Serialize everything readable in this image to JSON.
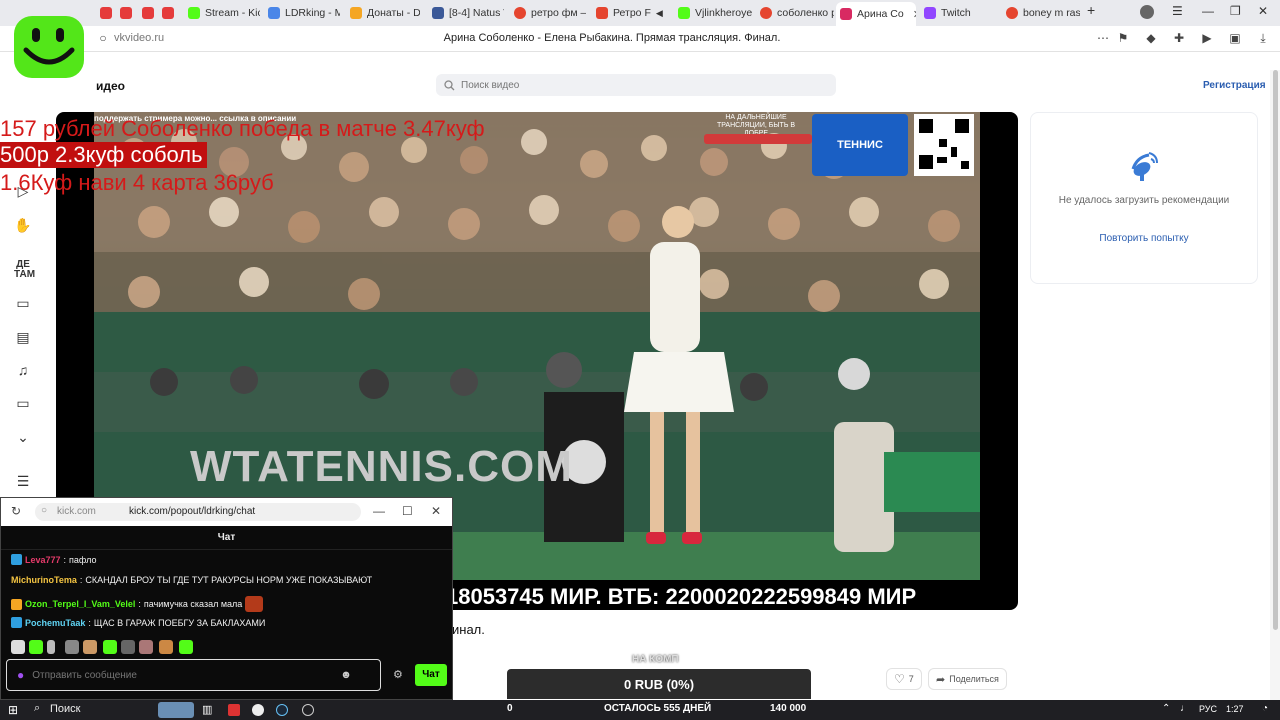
{
  "browser": {
    "tabs": [
      {
        "label": "Stream - Kick",
        "color": "#53fc18"
      },
      {
        "label": "LDRking - Me",
        "color": "#4a86e8"
      },
      {
        "label": "Донаты - Do",
        "color": "#f5a623"
      },
      {
        "label": "[8-4] Natus V",
        "color": "#3b5998"
      },
      {
        "label": "ретро фм —",
        "color": "#e5452f"
      },
      {
        "label": "Ретро F",
        "color": "#e5452f"
      },
      {
        "label": "Vjlinkheroye",
        "color": "#53fc18"
      },
      {
        "label": "соболенко р",
        "color": "#e5452f"
      },
      {
        "label": "Арина Со",
        "color": "#d82a62",
        "active": true
      },
      {
        "label": "Twitch",
        "color": "#9146ff"
      },
      {
        "label": "boney m rasp",
        "color": "#e5452f"
      }
    ],
    "url": "vkvideo.ru",
    "page_title": "Арина Соболенко - Елена Рыбакина. Прямая трансляция. Финал."
  },
  "header": {
    "brand": "идео",
    "search_placeholder": "Поиск видео",
    "register": "Регистрация"
  },
  "video": {
    "promo_left": "поддержать стримера можно... ссылка в описании",
    "promo_right": "НА ДАЛЬНЕЙШИЕ ТРАНСЛЯЦИИ, БЫТЬ В ДОБРЕ",
    "tennis_logo": "ТЕННИС",
    "banner_text": "WTATENNIS.COM",
    "ticker": "18053745 МИР. ВТБ: 2200020222599849 МИР"
  },
  "overlay": {
    "line1": "157 рублей Соболенко победа в матче 3.47куф",
    "line2": "500р 2.3куф соболь",
    "line3": "1.6Куф нави 4 карта 36руб"
  },
  "under_title": "инал.",
  "right_panel": {
    "message": "Не удалось загрузить рекомендации",
    "retry": "Повторить попытку"
  },
  "actions": {
    "likes": "7",
    "share": "Поделиться"
  },
  "donation": {
    "label": "НА КОМП",
    "value": "0 RUB (0%)"
  },
  "chat": {
    "host": "kick.com",
    "url": "kick.com/popout/ldrking/chat",
    "header": "Чат",
    "messages": [
      {
        "user": "Leva777",
        "text": "пафло",
        "color": "#e53b6a",
        "badge": "#2f9fe0"
      },
      {
        "user": "MichurinoTema",
        "text": "СКАНДАЛ БРОУ ТЫ ГДЕ ТУТ РАКУРСЫ НОРМ УЖЕ ПОКАЗЫВАЮТ",
        "color": "#f5c542",
        "badge": ""
      },
      {
        "user": "Ozon_Terpel_I_Vam_Velel",
        "text": "пачимучка сказал мала",
        "color": "#53fc18",
        "badge": "#f5a623"
      },
      {
        "user": "PochemuTaak",
        "text": "ЩАС В ГАРАЖ ПОЕБГУ ЗА БАКЛАХАМИ",
        "color": "#5fd3f3",
        "badge": "#2f9fe0"
      }
    ],
    "input_placeholder": "Отправить сообщение",
    "send_label": "Чат"
  },
  "taskbar": {
    "search": "Поиск",
    "counter_left": "0",
    "center": "ОСТАЛОСЬ 555 ДНЕЙ",
    "counter_right": "140 000",
    "lang": "РУС",
    "time": "1:27"
  }
}
